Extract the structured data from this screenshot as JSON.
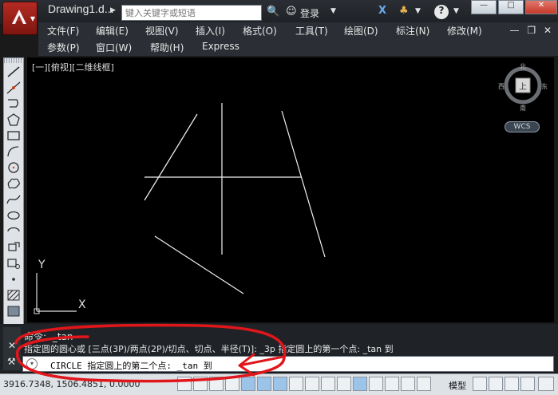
{
  "title_bar": {
    "doc_title": "Drawing1.d...",
    "search_placeholder": "键入关键字或短语",
    "login": "登录"
  },
  "menus": {
    "row1": [
      "文件(F)",
      "编辑(E)",
      "视图(V)",
      "插入(I)",
      "格式(O)",
      "工具(T)",
      "绘图(D)",
      "标注(N)",
      "修改(M)"
    ],
    "row2": [
      "参数(P)",
      "窗口(W)",
      "帮助(H)",
      "Express"
    ]
  },
  "viewport": {
    "label": "[一][俯视][二维线框]",
    "viewcube": {
      "north": "北",
      "south": "南",
      "east": "东",
      "west": "西",
      "face": "上"
    },
    "wcs": "WCS",
    "ucs_x": "X",
    "ucs_y": "Y"
  },
  "command": {
    "line1_prefix": "命令:",
    "line1_value": "_tan",
    "line2": "指定圆的圆心或 [三点(3P)/两点(2P)/切点、切点、半径(T)]: _3p 指定圆上的第一个点: _tan 到",
    "input": "CIRCLE 指定圆上的第二个点: _tan 到"
  },
  "status": {
    "coordinates": "3916.7348, 1506.4851, 0.0000",
    "model": "模型"
  },
  "colors": {
    "canvas": "#000000",
    "annotation": "#e0161b",
    "dark_ui": "#2b2f35"
  }
}
